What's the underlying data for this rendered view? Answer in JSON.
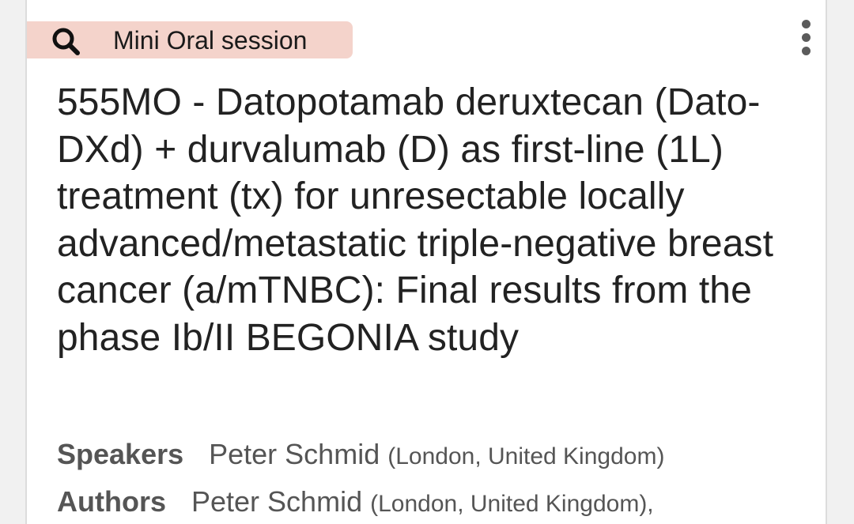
{
  "session": {
    "icon": "search-icon",
    "label": "Mini Oral session",
    "badge_color": "#f4d3cb"
  },
  "menu": {
    "icon": "more-vertical-icon"
  },
  "abstract": {
    "title": "555MO - Datopotamab deruxtecan (Dato-DXd) + durvalumab (D) as first-line (1L) treatment (tx) for unresectable locally advanced/metastatic triple-negative breast cancer (a/mTNBC): Final results from the phase Ib/II BEGONIA study"
  },
  "speakers": {
    "label": "Speakers",
    "name": "Peter Schmid",
    "affiliation": "(London, United Kingdom)"
  },
  "authors": {
    "label": "Authors",
    "name": "Peter Schmid",
    "affiliation": "(London, United Kingdom),"
  }
}
